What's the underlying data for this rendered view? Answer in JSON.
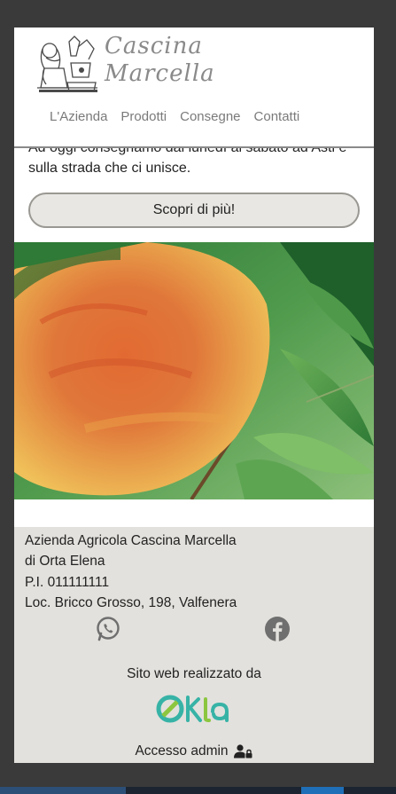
{
  "brand": {
    "line1": "Cascina",
    "line2": "Marcella"
  },
  "nav": {
    "items": [
      "L'Azienda",
      "Prodotti",
      "Consegne",
      "Contatti"
    ]
  },
  "intro": {
    "text": "Ad oggi consegnamo dal lunedì al sabato ad Asti e sulla strada che ci unisce."
  },
  "cta": {
    "label": "Scopri di più!"
  },
  "footer": {
    "company": "Azienda Agricola Cascina Marcella",
    "owner": "di Orta Elena",
    "vat": "P.I. 011111111",
    "address": "Loc. Bricco Grosso, 198, Valfenera",
    "social_icons": [
      "whatsapp-icon",
      "facebook-icon"
    ],
    "credit": "Sito web realizzato da",
    "credit_logo": "OKTA",
    "admin_label": "Accesso admin"
  },
  "colors": {
    "nav": "#7a7a7a",
    "footer_bg": "#e3e1dd",
    "button_bg": "#e8e7e3",
    "logo_teal": "#37b3a6"
  }
}
